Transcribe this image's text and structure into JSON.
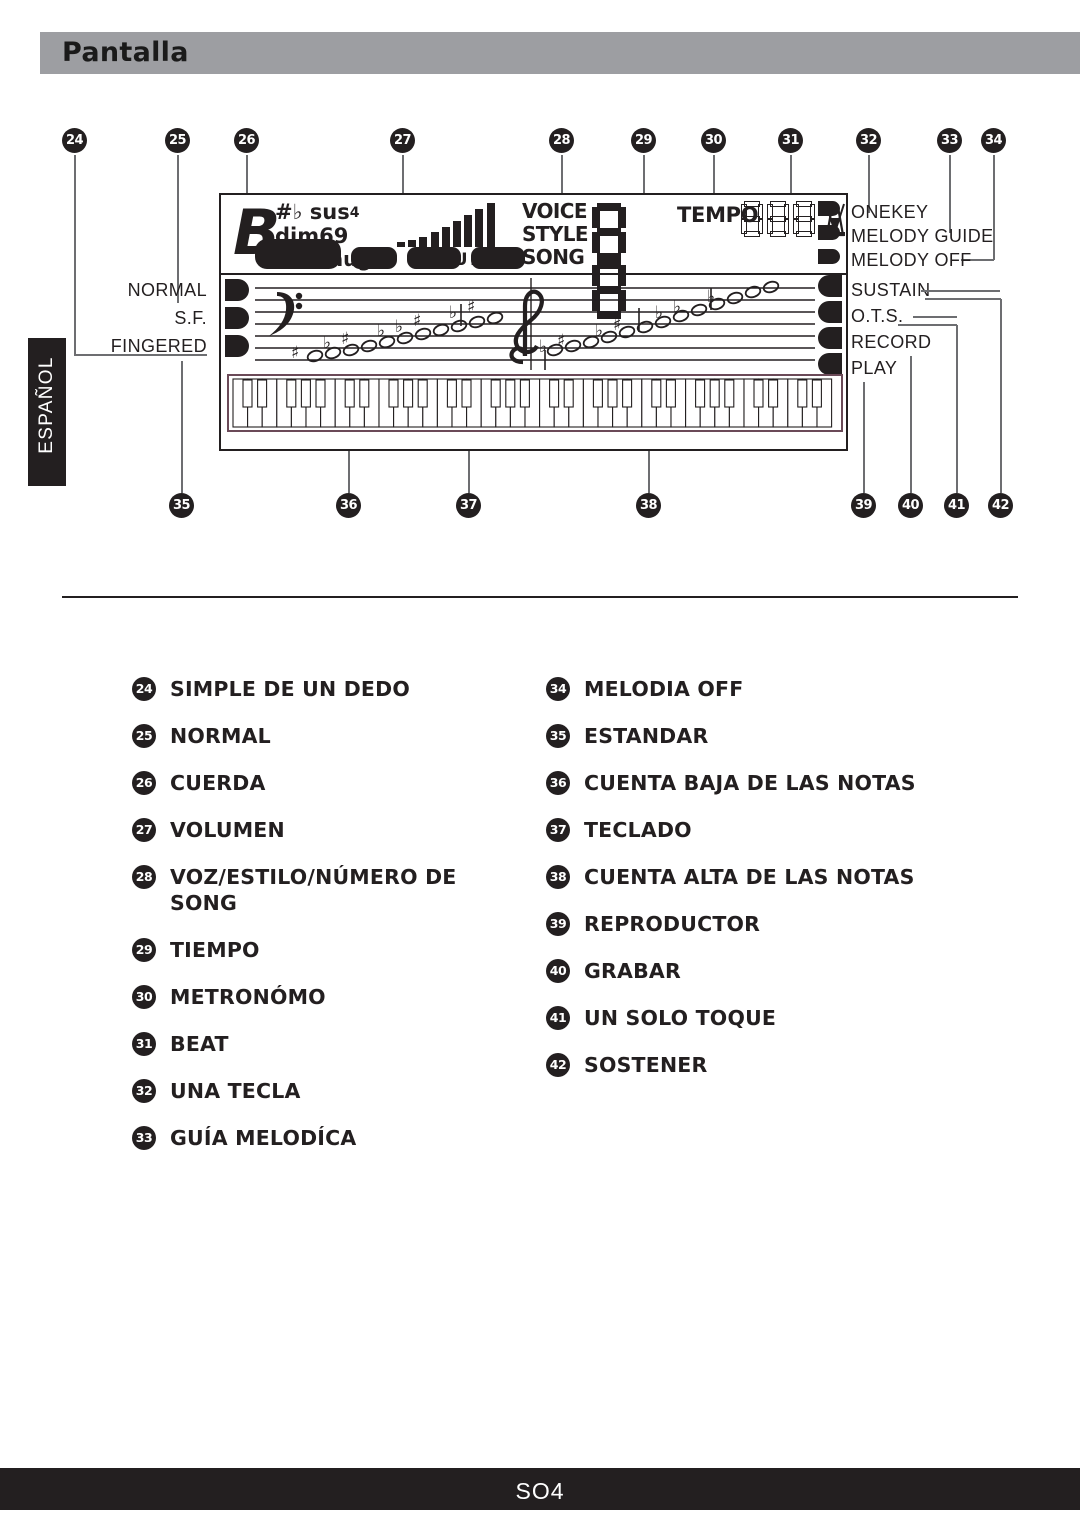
{
  "header": {
    "title": "Pantalla"
  },
  "sidebar": {
    "language_tab": "ESPAÑOL"
  },
  "footer": {
    "page_code": "SO4"
  },
  "lcd": {
    "chord_root": "B",
    "chord_row1": "#♭ sus",
    "chord_row1_sup": "4",
    "chord_row2": "dim69",
    "chord_row3": "mM7aug",
    "volume_label": "VOLUME",
    "voice_label": "VOICE",
    "style_label": "STYLE",
    "song_label": "SONG",
    "tempo_label": "TEMPO",
    "number_display": "88",
    "tempo_display": "888",
    "metronome_icon": "metronome-icon"
  },
  "lcd_left_labels": [
    "NORMAL",
    "S.F.",
    "FINGERED"
  ],
  "lcd_right_labels_top": [
    "ONEKEY",
    "MELODY GUIDE",
    "MELODY OFF"
  ],
  "lcd_right_labels_bottom": [
    "SUSTAIN",
    "O.T.S.",
    "RECORD",
    "PLAY"
  ],
  "callouts_top": [
    "24",
    "25",
    "26",
    "27",
    "28",
    "29",
    "30",
    "31",
    "32",
    "33",
    "34"
  ],
  "callouts_bottom": [
    "35",
    "36",
    "37",
    "38",
    "39",
    "40",
    "41",
    "42"
  ],
  "legend": {
    "left": [
      {
        "num": "24",
        "label": "SIMPLE DE UN DEDO"
      },
      {
        "num": "25",
        "label": "NORMAL"
      },
      {
        "num": "26",
        "label": "CUERDA"
      },
      {
        "num": "27",
        "label": "VOLUMEN"
      },
      {
        "num": "28",
        "label": "VOZ/ESTILO/NÚMERO   DE\nSONG"
      },
      {
        "num": "29",
        "label": "TIEMPO"
      },
      {
        "num": "30",
        "label": "METRONÓMO"
      },
      {
        "num": "31",
        "label": "BEAT"
      },
      {
        "num": "32",
        "label": "UNA TECLA"
      },
      {
        "num": "33",
        "label": "GUÍA  MELODÍCA"
      }
    ],
    "right": [
      {
        "num": "34",
        "label": "MELODIA OFF"
      },
      {
        "num": "35",
        "label": "ESTANDAR"
      },
      {
        "num": "36",
        "label": "CUENTA BAJA DE LAS NOTAS"
      },
      {
        "num": "37",
        "label": "TECLADO"
      },
      {
        "num": "38",
        "label": "CUENTA ALTA DE LAS NOTAS"
      },
      {
        "num": "39",
        "label": "REPRODUCTOR"
      },
      {
        "num": "40",
        "label": "GRABAR"
      },
      {
        "num": "41",
        "label": "UN SOLO TOQUE"
      },
      {
        "num": "42",
        "label": "SOSTENER"
      }
    ]
  },
  "colors": {
    "header_bg": "#9d9ea2",
    "ink": "#231f20",
    "lead_line": "#6d6e71",
    "footer_bg": "#231f20"
  }
}
